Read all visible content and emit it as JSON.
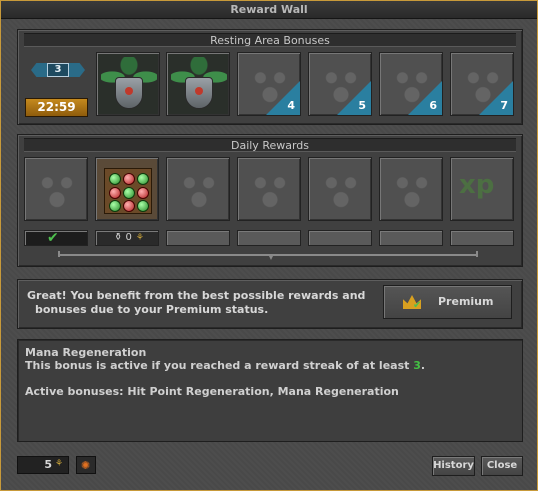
{
  "window": {
    "title": "Reward Wall"
  },
  "resting_area": {
    "title": "Resting Area Bonuses",
    "streak": "3",
    "timer": "22:59",
    "bonus_slots": [
      {
        "state": "active",
        "icon": "dragon-shield-icon"
      },
      {
        "state": "active",
        "icon": "dragon-shield-icon"
      },
      {
        "state": "locked",
        "icon": "dragon-shield-icon",
        "level": "4"
      },
      {
        "state": "locked",
        "icon": "dragon-shield-icon",
        "level": "5"
      },
      {
        "state": "locked",
        "icon": "dragon-shield-icon",
        "level": "6"
      },
      {
        "state": "locked",
        "icon": "dragon-shield-icon",
        "level": "7"
      }
    ]
  },
  "daily_rewards": {
    "title": "Daily Rewards",
    "days": [
      {
        "state": "claimed",
        "icon": "potions-icon"
      },
      {
        "state": "current",
        "icon": "potion-chest-icon",
        "cost": "0"
      },
      {
        "state": "future",
        "icon": "rune-grid-icon"
      },
      {
        "state": "future",
        "icon": "potions-icon"
      },
      {
        "state": "future",
        "icon": "potions-icon"
      },
      {
        "state": "future",
        "icon": "rune-grid-icon"
      },
      {
        "state": "future",
        "icon": "xp-boost-icon",
        "label": "xp"
      }
    ]
  },
  "premium_info": {
    "message_line1": "Great! You benefit from the best possible rewards and",
    "message_line2": "bonuses due to your Premium status.",
    "button_label": "Premium"
  },
  "details": {
    "heading": "Mana Regeneration",
    "line_prefix": "This bonus is active if you reached a reward streak of at least ",
    "streak_value": "3",
    "line_suffix": ".",
    "active_bonuses": "Active bonuses: Hit Point Regeneration, Mana Regeneration"
  },
  "footer": {
    "jokers": "5",
    "history_label": "History",
    "close_label": "Close"
  },
  "colors": {
    "accent_gold": "#c89a3a",
    "timer_bg": "#b07818",
    "locked_corner": "#2a7fa0",
    "check_green": "#4ec04e"
  }
}
